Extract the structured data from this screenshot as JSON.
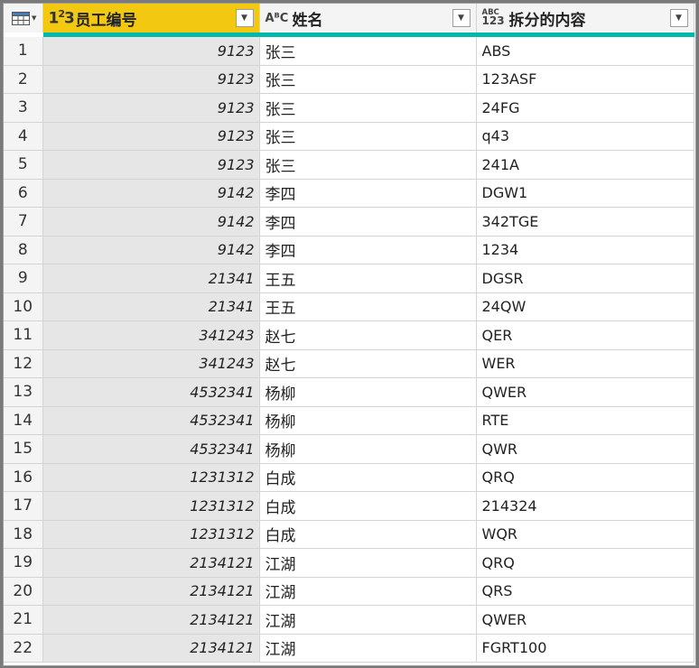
{
  "columns": [
    {
      "type_icon": "1²3",
      "label": "员工编号"
    },
    {
      "type_icon": "ABC",
      "label": "姓名"
    },
    {
      "type_icon": "ABC/123",
      "label": "拆分的内容"
    }
  ],
  "type_icons": {
    "col0_top": "1",
    "col0_sup": "2",
    "col0_bot": "3",
    "col1": "AᴮC",
    "col2_top": "ABC",
    "col2_bot": "123"
  },
  "filter_glyph": "▼",
  "rows": [
    {
      "index": "1",
      "id": "9123",
      "name": "张三",
      "split": "ABS"
    },
    {
      "index": "2",
      "id": "9123",
      "name": "张三",
      "split": "123ASF"
    },
    {
      "index": "3",
      "id": "9123",
      "name": "张三",
      "split": "24FG"
    },
    {
      "index": "4",
      "id": "9123",
      "name": "张三",
      "split": "q43"
    },
    {
      "index": "5",
      "id": "9123",
      "name": "张三",
      "split": "241A"
    },
    {
      "index": "6",
      "id": "9142",
      "name": "李四",
      "split": "DGW1"
    },
    {
      "index": "7",
      "id": "9142",
      "name": "李四",
      "split": "342TGE"
    },
    {
      "index": "8",
      "id": "9142",
      "name": "李四",
      "split": "1234"
    },
    {
      "index": "9",
      "id": "21341",
      "name": "王五",
      "split": "DGSR"
    },
    {
      "index": "10",
      "id": "21341",
      "name": "王五",
      "split": "24QW"
    },
    {
      "index": "11",
      "id": "341243",
      "name": "赵七",
      "split": "QER"
    },
    {
      "index": "12",
      "id": "341243",
      "name": "赵七",
      "split": "WER"
    },
    {
      "index": "13",
      "id": "4532341",
      "name": "杨柳",
      "split": "QWER"
    },
    {
      "index": "14",
      "id": "4532341",
      "name": "杨柳",
      "split": "RTE"
    },
    {
      "index": "15",
      "id": "4532341",
      "name": "杨柳",
      "split": "QWR"
    },
    {
      "index": "16",
      "id": "1231312",
      "name": "白成",
      "split": "QRQ"
    },
    {
      "index": "17",
      "id": "1231312",
      "name": "白成",
      "split": "214324"
    },
    {
      "index": "18",
      "id": "1231312",
      "name": "白成",
      "split": "WQR"
    },
    {
      "index": "19",
      "id": "2134121",
      "name": "江湖",
      "split": "QRQ"
    },
    {
      "index": "20",
      "id": "2134121",
      "name": "江湖",
      "split": "QRS"
    },
    {
      "index": "21",
      "id": "2134121",
      "name": "江湖",
      "split": "QWER"
    },
    {
      "index": "22",
      "id": "2134121",
      "name": "江湖",
      "split": "FGRT100"
    }
  ],
  "colors": {
    "selected_header": "#f2c811",
    "quality_bar": "#01b8aa",
    "selected_column": "#e6e6e6"
  }
}
